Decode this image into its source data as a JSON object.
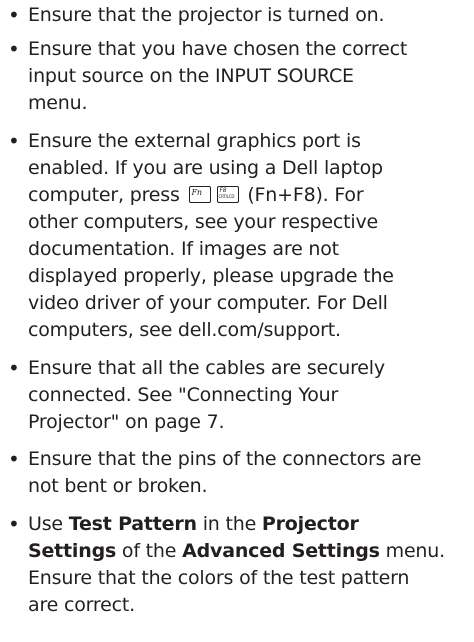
{
  "bullet_char": "•",
  "items": [
    {
      "lines": [
        "Ensure that the projector is turned on."
      ]
    },
    {
      "lines": [
        "Ensure that you have chosen the correct",
        "input source on the INPUT SOURCE",
        "menu."
      ]
    },
    {
      "lines": [
        "Ensure the external graphics port is",
        "enabled. If you are using a Dell laptop"
      ],
      "key_line": {
        "before": "computer, press",
        "key_fn_label": "Fn",
        "key_f8_top": "F8",
        "key_f8_bottom": "CRT/LCD",
        "after": "(Fn+F8). For"
      },
      "lines_after": [
        "other computers, see your respective",
        "documentation. If images are not",
        "displayed properly, please upgrade the",
        "video driver of your computer. For Dell",
        "computers, see dell.com/support."
      ]
    },
    {
      "lines": [
        "Ensure that all the cables are securely",
        "connected. See \"Connecting Your",
        "Projector\" on page 7."
      ]
    },
    {
      "lines": [
        "Ensure that the pins of the connectors are",
        "not bent or broken."
      ]
    },
    {
      "rich_lines": [
        {
          "a": "Use ",
          "b1": "Test Pattern",
          "c": " in the ",
          "b2": "Projector"
        },
        {
          "b1": "Settings",
          "c": " of the ",
          "b2": "Advanced Settings",
          "d": " menu."
        }
      ],
      "lines": [
        "Ensure that the colors of the test pattern",
        "are correct."
      ]
    }
  ]
}
